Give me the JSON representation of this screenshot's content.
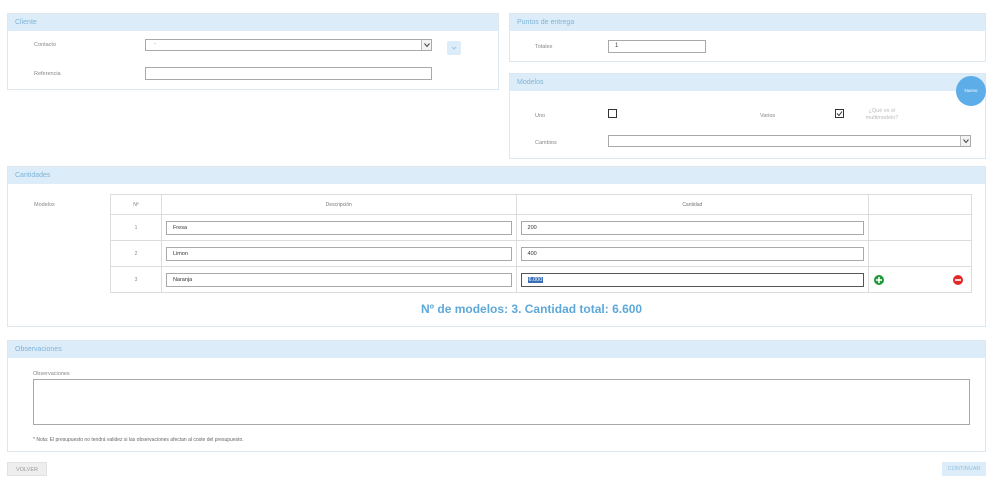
{
  "cliente": {
    "title": "Cliente",
    "contacto_label": "Contacto",
    "contacto_value": "-",
    "referencia_label": "Referencia",
    "referencia_value": ""
  },
  "puntos": {
    "title": "Puntos de entrega",
    "totales_label": "Totales",
    "totales_value": "1"
  },
  "modelos": {
    "title": "Modelos",
    "nuevo_label": "Nuevo",
    "uno_label": "Uno",
    "uno_checked": false,
    "varios_label": "Varios",
    "varios_checked": true,
    "help_label": "¿Qué es el multimodelo?",
    "cambios_label": "Cambios",
    "cambios_value": ""
  },
  "cantidades": {
    "title": "Cantidades",
    "modelos_label": "Modelos",
    "headers": [
      "Nº",
      "Descripción",
      "Cantidad"
    ],
    "rows": [
      {
        "n": "1",
        "descripcion": "Fresa",
        "cantidad": "200"
      },
      {
        "n": "2",
        "descripcion": "Limon",
        "cantidad": "400"
      },
      {
        "n": "3",
        "descripcion": "Naranja",
        "cantidad": "6.000"
      }
    ],
    "summary": "Nº de modelos: 3. Cantidad total: 6.600"
  },
  "observaciones": {
    "title": "Observaciones",
    "field_label": "Observaciones",
    "value": "",
    "note": "* Nota: El presupuesto no tendrá validez si las observaciones afectan al coste del presupuesto."
  },
  "footer": {
    "volver": "VOLVER",
    "continuar": "CONTINUAR"
  },
  "colors": {
    "panel_header_bg": "#dcecf8",
    "panel_header_text": "#7fb4d8",
    "accent": "#5dade8",
    "add_green": "#1e9b3b",
    "remove_red": "#e02b2b"
  }
}
